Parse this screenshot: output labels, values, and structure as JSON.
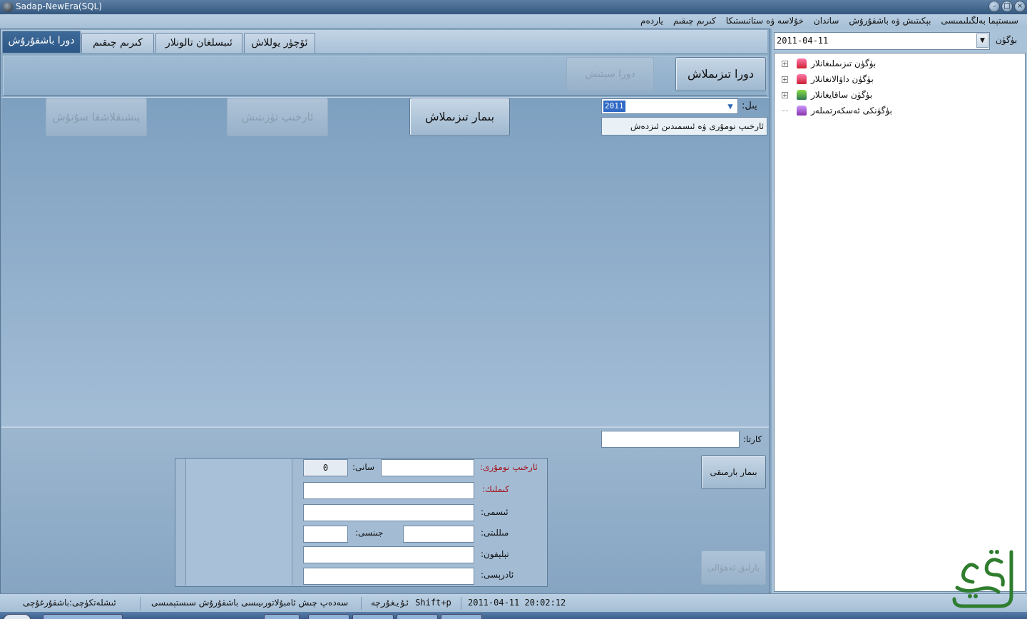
{
  "window": {
    "title": "Sadap-NewEra(SQL)"
  },
  "menu": [
    "سىستېما بەلگىلىمىسى",
    "بېكىتىش ۋە باشقۇرۇش",
    "ساندان",
    "خۇلاسە ۋە ستاتىستىكا",
    "كىرىم چىقىم",
    "ياردەم"
  ],
  "tabs": [
    {
      "label": "دورا باشقۇرۇش",
      "active": true
    },
    {
      "label": "كىرىم چىقىم",
      "active": false
    },
    {
      "label": "ئىبسلغان تالونلار",
      "active": false
    },
    {
      "label": "ئۆچۈر يوللاش",
      "active": false
    }
  ],
  "toolbar": {
    "register_drug": "دورا تىزىملاش",
    "sell_drug": "دورا سېتىش"
  },
  "actions": {
    "register_patient": "بىمار تىزىملاش",
    "edit_record": "ئارخىپ تۈزىتىش",
    "delete_treatment": "پىشىقلاشقا سۇنۇش"
  },
  "year": {
    "label": "يىل:",
    "value": "2011"
  },
  "search_by": "ئارخىپ نومۇرى ۋە ئىسمىدىن ئىزدەش",
  "card": {
    "label": "كارتا:",
    "value": ""
  },
  "patient": {
    "archive_no_label": "ئارخىپ نومۇرى:",
    "count_label": "سانى:",
    "count_value": "0",
    "id_label": "كىملىك:",
    "name_label": "ئىسمى:",
    "nation_label": "مىللىتى:",
    "gender_label": "جىنسى:",
    "phone_label": "تېلېفون:",
    "address_label": "ئادرېسى:"
  },
  "side_buttons": {
    "patient_page": "بىمار بارمىقى",
    "all_status": "بارلىق ئەھۋالى"
  },
  "date_filter": {
    "label": "بۈگۈن",
    "value": "2011-04-11"
  },
  "tree": [
    {
      "label": "بۈگۈن تىزىملىغانلار",
      "expandable": true,
      "icon": "person-red-icon"
    },
    {
      "label": "بۈگۈن داۋالانغانلار",
      "expandable": true,
      "icon": "person-red-icon"
    },
    {
      "label": "بۈگۈن ساقايغانلار",
      "expandable": true,
      "icon": "person-green-icon"
    },
    {
      "label": "بۈگۈنكى ئەسكەرتمىلەر",
      "expandable": false,
      "icon": "person-purple-icon"
    }
  ],
  "status": {
    "user": "ئىشلەتكۈچى:باشقۇرغۇچى",
    "system": "سەدەپ چىش ئامبۇلاتورىيىسى باشقۇرۇش سىستېمىسى",
    "shortcut": "ئۇيغۇرچە Shift+p",
    "datetime": "2011-04-11 20:02:12"
  },
  "colors": {
    "accent": "#2b5686",
    "background": "#89a9c4",
    "required_label": "#a3141c"
  }
}
